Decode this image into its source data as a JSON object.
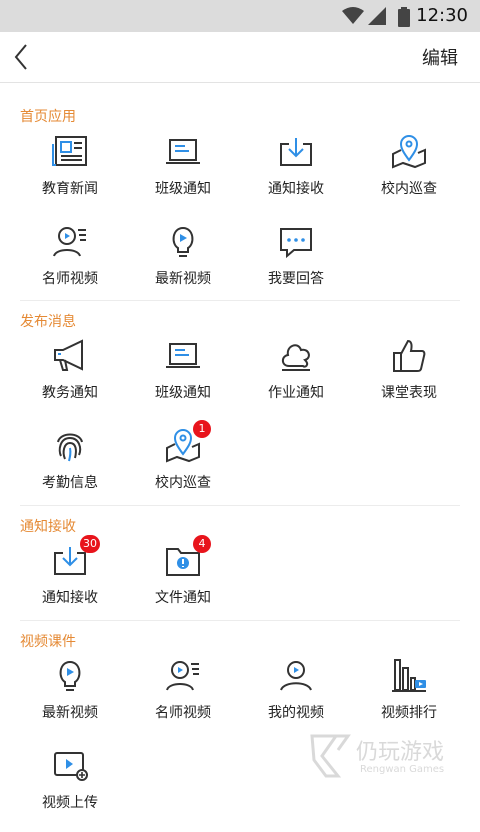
{
  "status_bar": {
    "time": "12:30"
  },
  "header": {
    "edit_label": "编辑"
  },
  "sections": [
    {
      "title": "首页应用",
      "items": [
        {
          "label": "教育新闻",
          "icon": "news-icon"
        },
        {
          "label": "班级通知",
          "icon": "laptop-icon"
        },
        {
          "label": "通知接收",
          "icon": "download-tray-icon"
        },
        {
          "label": "校内巡查",
          "icon": "map-pin-icon"
        },
        {
          "label": "名师视频",
          "icon": "teacher-video-icon"
        },
        {
          "label": "最新视频",
          "icon": "lightbulb-play-icon"
        },
        {
          "label": "我要回答",
          "icon": "chat-bubble-icon"
        }
      ]
    },
    {
      "title": "发布消息",
      "items": [
        {
          "label": "教务通知",
          "icon": "megaphone-icon"
        },
        {
          "label": "班级通知",
          "icon": "laptop-icon"
        },
        {
          "label": "作业通知",
          "icon": "cloud-tree-icon"
        },
        {
          "label": "课堂表现",
          "icon": "thumbs-up-icon"
        },
        {
          "label": "考勤信息",
          "icon": "fingerprint-icon"
        },
        {
          "label": "校内巡查",
          "icon": "map-pin-icon",
          "badge": "1"
        }
      ]
    },
    {
      "title": "通知接收",
      "items": [
        {
          "label": "通知接收",
          "icon": "download-tray-icon",
          "badge": "30"
        },
        {
          "label": "文件通知",
          "icon": "folder-alert-icon",
          "badge": "4"
        }
      ]
    },
    {
      "title": "视频课件",
      "items": [
        {
          "label": "最新视频",
          "icon": "lightbulb-play-icon"
        },
        {
          "label": "名师视频",
          "icon": "teacher-video-icon"
        },
        {
          "label": "我的视频",
          "icon": "user-video-icon"
        },
        {
          "label": "视频排行",
          "icon": "bar-chart-video-icon"
        },
        {
          "label": "视频上传",
          "icon": "video-upload-icon"
        }
      ]
    }
  ],
  "watermark": {
    "text": "仍玩游戏",
    "subtext": "Rengwan Games"
  },
  "colors": {
    "accent": "#e58a35",
    "icon_stroke": "#333333",
    "icon_blue": "#2f8fe6",
    "badge": "#e8141c"
  }
}
